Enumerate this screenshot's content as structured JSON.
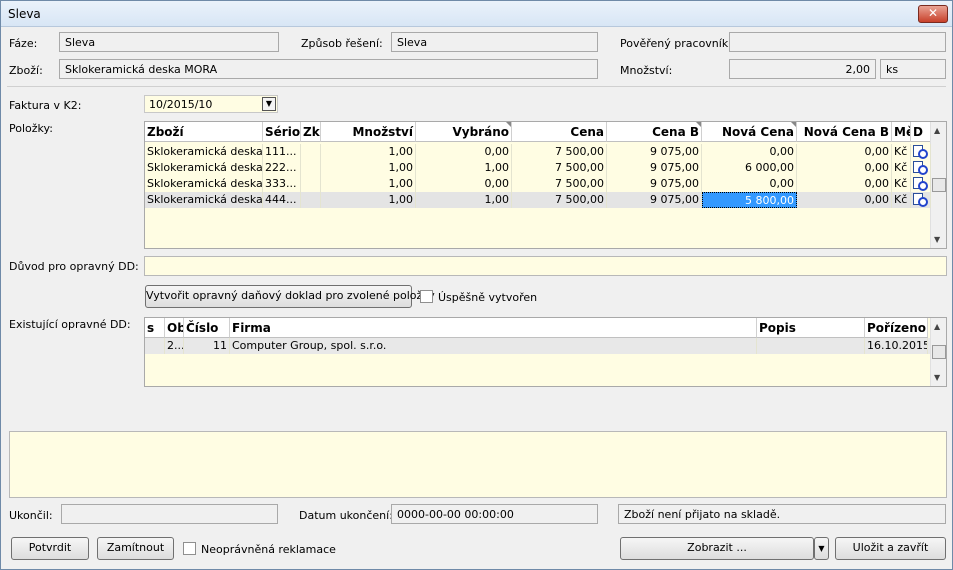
{
  "window": {
    "title": "Sleva",
    "close_glyph": "✕"
  },
  "header": {
    "faze_label": "Fáze:",
    "faze_value": "Sleva",
    "zpusob_label": "Způsob řešení:",
    "zpusob_value": "Sleva",
    "povereny_label": "Pověřený pracovník:",
    "povereny_value": "",
    "zbozi_label": "Zboží:",
    "zbozi_value": "Sklokeramická deska MORA",
    "mnozstvi_label": "Množství:",
    "mnozstvi_value": "2,00",
    "mnozstvi_unit": "ks"
  },
  "faktura": {
    "label": "Faktura v K2:",
    "value": "10/2015/10"
  },
  "polozky": {
    "label": "Položky:",
    "columns": [
      "Zboží",
      "Sériov",
      "Zkr",
      "Množství",
      "Vybráno",
      "Cena",
      "Cena B",
      "Nová Cena",
      "Nová Cena B",
      "Mě",
      "D"
    ],
    "rows": [
      [
        "Sklokeramická deska ...",
        "111...",
        "",
        "1,00",
        "0,00",
        "7 500,00",
        "9 075,00",
        "0,00",
        "0,00",
        "Kč"
      ],
      [
        "Sklokeramická deska ...",
        "222...",
        "",
        "1,00",
        "1,00",
        "7 500,00",
        "9 075,00",
        "6 000,00",
        "0,00",
        "Kč"
      ],
      [
        "Sklokeramická deska ...",
        "333...",
        "",
        "1,00",
        "0,00",
        "7 500,00",
        "9 075,00",
        "0,00",
        "0,00",
        "Kč"
      ],
      [
        "Sklokeramická deska ...",
        "444...",
        "",
        "1,00",
        "1,00",
        "7 500,00",
        "9 075,00",
        "5 800,00",
        "0,00",
        "Kč"
      ]
    ]
  },
  "duvod": {
    "label": "Důvod pro opravný DD:",
    "value": ""
  },
  "vytvorit": {
    "button_label": "Vytvořit opravný daňový doklad pro zvolené položky",
    "checkbox_label": "Úspěšně vytvořen"
  },
  "existujici": {
    "label": "Existující opravné DD:",
    "columns": [
      "s",
      "Ob",
      "Číslo",
      "Firma",
      "Popis",
      "Pořízeno"
    ],
    "rows": [
      [
        "",
        "2...",
        "11",
        "Computer Group, spol. s.r.o.",
        "",
        "16.10.2015"
      ]
    ]
  },
  "footer": {
    "ukoncil_label": "Ukončil:",
    "ukoncil_value": "",
    "datum_label": "Datum ukončení:",
    "datum_value": "0000-00-00 00:00:00",
    "status_text": "Zboží není přijato na skladě."
  },
  "buttons": {
    "potvrdit": "Potvrdit",
    "zamitnout": "Zamítnout",
    "neopravnena_label": "Neoprávněná reklamace",
    "zobrazit": "Zobrazit ...",
    "ulozit": "Uložit a zavřít"
  },
  "colors": {
    "field_yellow": "#fffde3",
    "selection": "#3399ff"
  }
}
